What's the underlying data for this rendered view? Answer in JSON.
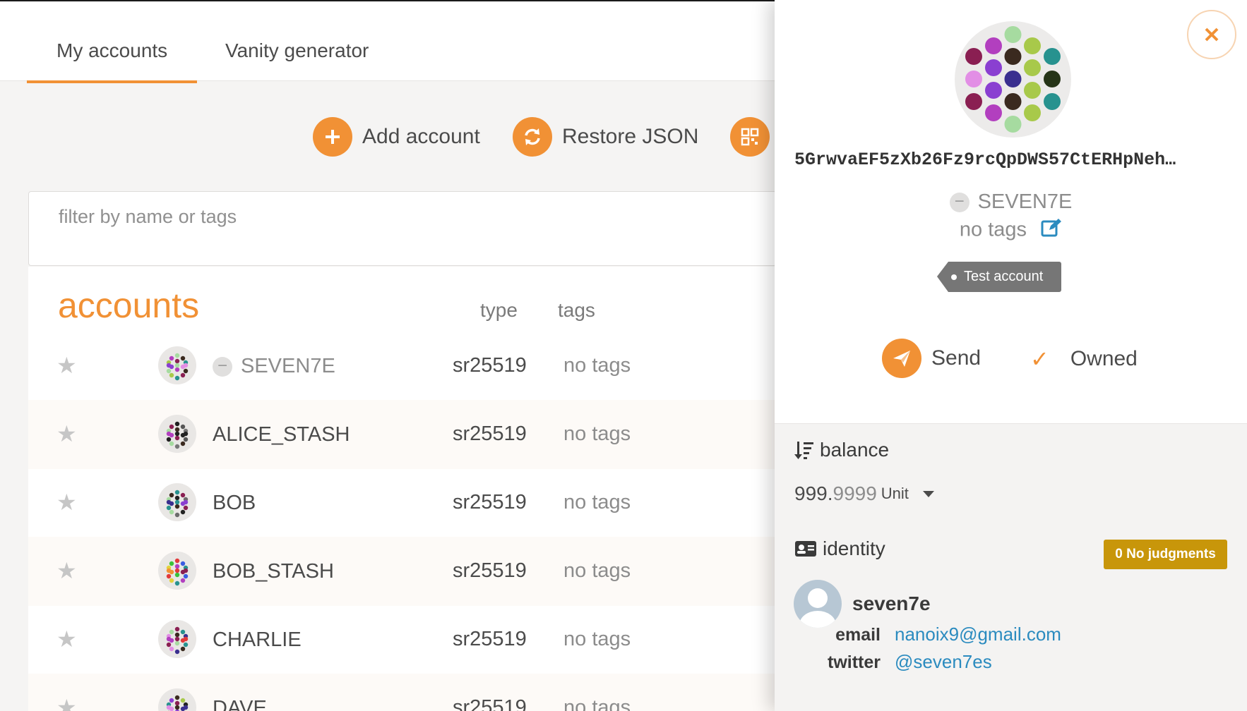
{
  "tabs": [
    {
      "label": "My accounts",
      "active": true
    },
    {
      "label": "Vanity generator",
      "active": false
    }
  ],
  "actions": {
    "add_account": "Add account",
    "restore_json": "Restore JSON"
  },
  "filter": {
    "placeholder": "filter by name or tags",
    "value": ""
  },
  "table": {
    "title": "accounts",
    "col_type": "type",
    "col_tags": "tags",
    "rows": [
      {
        "name": "SEVEN7E",
        "type": "sr25519",
        "tags": "no tags"
      },
      {
        "name": "ALICE_STASH",
        "type": "sr25519",
        "tags": "no tags"
      },
      {
        "name": "BOB",
        "type": "sr25519",
        "tags": "no tags"
      },
      {
        "name": "BOB_STASH",
        "type": "sr25519",
        "tags": "no tags"
      },
      {
        "name": "CHARLIE",
        "type": "sr25519",
        "tags": "no tags"
      },
      {
        "name": "DAVE",
        "type": "sr25519",
        "tags": "no tags"
      }
    ]
  },
  "sidebar": {
    "address": "5GrwvaEF5zXb26Fz9rcQpDWS57CtERHpNeh…",
    "name": "SEVEN7E",
    "tags": "no tags",
    "badge": "Test account",
    "send_label": "Send",
    "owned_label": "Owned",
    "balance": {
      "label": "balance",
      "whole": "999.",
      "decimals": "9999",
      "unit": "Unit"
    },
    "identity": {
      "label": "identity",
      "judgment_count": "0",
      "judgment_text": "No judgments",
      "display": "seven7e",
      "email_key": "email",
      "email": "nanoix9@gmail.com",
      "twitter_key": "twitter",
      "twitter": "@seven7es"
    }
  },
  "colors": {
    "accent": "#f19135",
    "judgment": "#c8960a",
    "link": "#2b8bbf"
  }
}
